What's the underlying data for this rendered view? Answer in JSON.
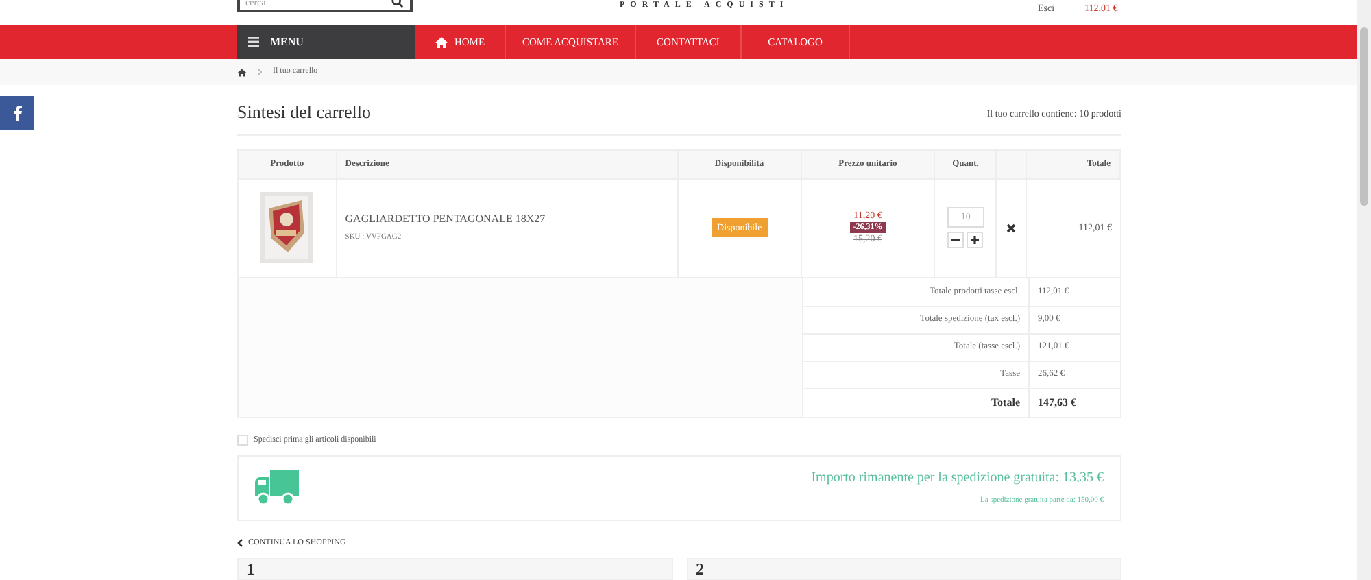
{
  "header": {
    "search": {
      "placeholder": "cerca"
    },
    "logo_tagline": "PORTALE ACQUISTI",
    "logout": "Esci",
    "cart_total": "112,01 €"
  },
  "nav": {
    "menu": "MENU",
    "items": [
      {
        "label": "HOME"
      },
      {
        "label": "COME ACQUISTARE"
      },
      {
        "label": "CONTATTACI"
      },
      {
        "label": "CATALOGO"
      }
    ]
  },
  "breadcrumb": [
    "Il tuo carrello"
  ],
  "title": "Sintesi del carrello",
  "cart_count": "Il tuo carrello contiene: 10 prodotti",
  "table": {
    "columns": [
      "Prodotto",
      "Descrizione",
      "Disponibilità",
      "Prezzo unitario",
      "Quant.",
      "Totale"
    ],
    "rows": [
      {
        "kind": "picture",
        "name": "GAGLIARDETTO PENTAGONALE 18X27",
        "sku": "SKU : VVFGAG2",
        "availability": "Disponibile",
        "price": "11,20 €",
        "discount": "-26,31%",
        "old_price": "15,20 €",
        "quantity": "10",
        "total": "112,01 €"
      }
    ],
    "totals": [
      {
        "label": "Totale prodotti tasse escl.",
        "value": "112,01 €",
        "bold": false
      },
      {
        "label": "Totale spedizione (tax escl.)",
        "value": "9,00 €",
        "bold": false
      },
      {
        "label": "Totale (tasse escl.)",
        "value": "121,01 €",
        "bold": false
      },
      {
        "label": "Tasse",
        "value": "26,62 €",
        "bold": false
      },
      {
        "label": "Totale",
        "value": "147,63 €",
        "bold": true
      }
    ]
  },
  "ship_first": {
    "label": "Spedisci prima gli articoli disponibili",
    "checked": false
  },
  "free_shipping": {
    "remaining": "Importo rimanente per la spedizione gratuita: 13,35 €",
    "threshold": "La spedizione gratuita parte da: 150,00 €"
  },
  "continue": "CONTINUA LO SHOPPING",
  "steps": [
    {
      "number": "1"
    },
    {
      "number": "2"
    }
  ]
}
